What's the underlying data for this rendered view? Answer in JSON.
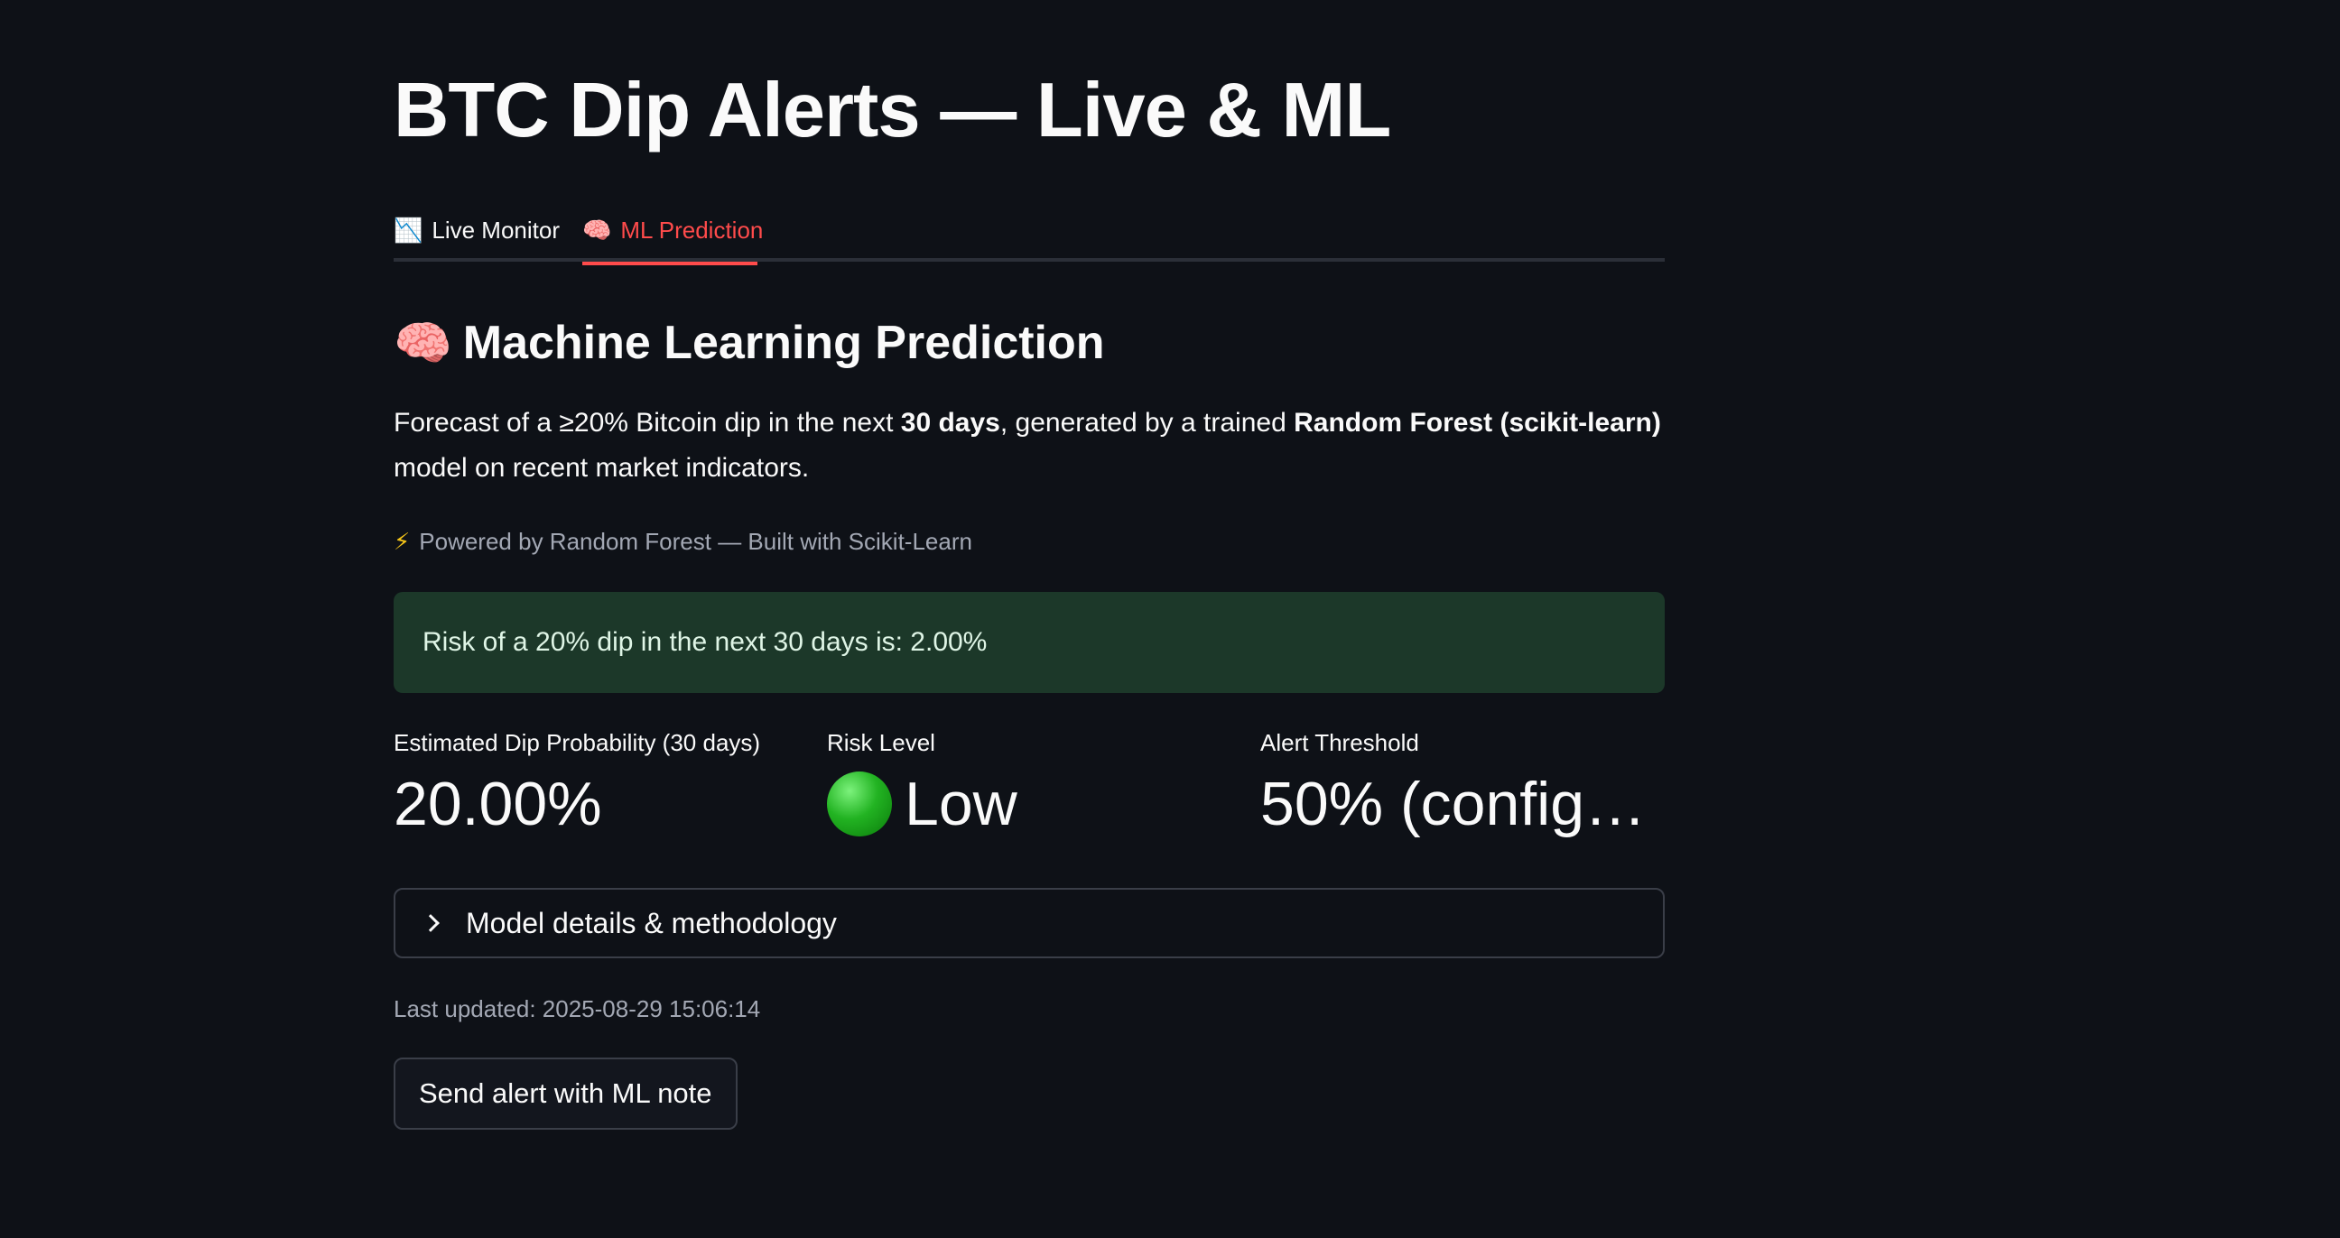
{
  "page": {
    "title": "BTC Dip Alerts — Live & ML"
  },
  "tabs": [
    {
      "icon": "📉",
      "icon_name": "chart-decreasing-icon",
      "label": "Live Monitor",
      "active": false
    },
    {
      "icon": "🧠",
      "icon_name": "brain-icon",
      "label": "ML Prediction",
      "active": true
    }
  ],
  "section": {
    "icon": "🧠",
    "icon_name": "brain-icon",
    "heading": "Machine Learning Prediction",
    "intro_part1": "Forecast of a ≥20% Bitcoin dip in the next ",
    "intro_bold1": "30 days",
    "intro_part2": ", generated by a trained ",
    "intro_bold2": "Random Forest (scikit-learn)",
    "intro_part3": " model on recent market indicators.",
    "powered_icon": "⚡",
    "powered_text": "Powered by Random Forest — Built with Scikit-Learn"
  },
  "success_message": "Risk of a 20% dip in the next 30 days is: 2.00%",
  "metrics": [
    {
      "label": "Estimated Dip Probability (30 days)",
      "value": "20.00%"
    },
    {
      "label": "Risk Level",
      "value": "Low",
      "icon_name": "green-circle-icon"
    },
    {
      "label": "Alert Threshold",
      "value": "50% (config…"
    }
  ],
  "expander": {
    "label": "Model details & methodology",
    "expanded": false
  },
  "last_updated": "Last updated: 2025-08-29 15:06:14",
  "send_button_label": "Send alert with ML note",
  "colors": {
    "background": "#0e1117",
    "accent": "#ff4b4b",
    "success_bg": "#1c3829",
    "muted_text": "#a3a8b4"
  }
}
